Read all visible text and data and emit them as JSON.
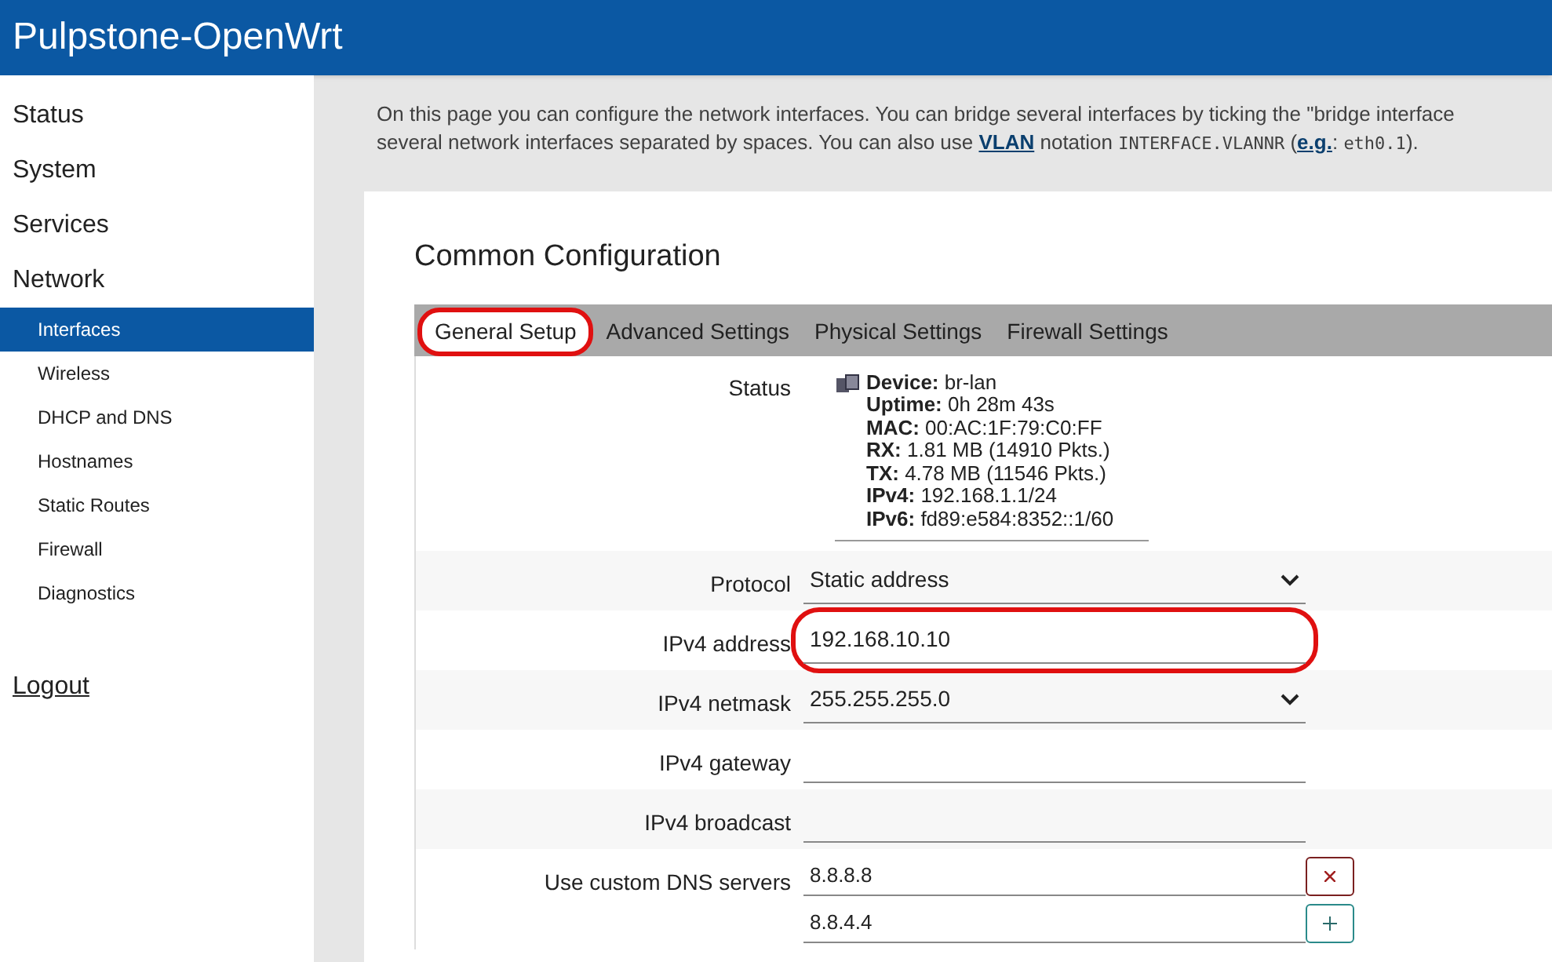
{
  "header": {
    "title": "Pulpstone-OpenWrt"
  },
  "sidebar": {
    "items": [
      {
        "label": "Status",
        "selected": false
      },
      {
        "label": "System",
        "selected": false
      },
      {
        "label": "Services",
        "selected": false
      },
      {
        "label": "Network",
        "selected": false,
        "children": [
          {
            "label": "Interfaces",
            "selected": true
          },
          {
            "label": "Wireless",
            "selected": false
          },
          {
            "label": "DHCP and DNS",
            "selected": false
          },
          {
            "label": "Hostnames",
            "selected": false
          },
          {
            "label": "Static Routes",
            "selected": false
          },
          {
            "label": "Firewall",
            "selected": false
          },
          {
            "label": "Diagnostics",
            "selected": false
          }
        ]
      }
    ],
    "logout": "Logout"
  },
  "description": {
    "line_1": "On this page you can configure the network interfaces. You can bridge several interfaces by ticking the \"bridge interface",
    "line_2": [
      {
        "kind": "text",
        "text": "several network interfaces separated by spaces. You can also use "
      },
      {
        "kind": "link",
        "text": "VLAN"
      },
      {
        "kind": "text",
        "text": " notation "
      },
      {
        "kind": "code",
        "text": "INTERFACE.VLANNR"
      },
      {
        "kind": "text",
        "text": " ("
      },
      {
        "kind": "link",
        "text": "e.g."
      },
      {
        "kind": "text",
        "text": ": "
      },
      {
        "kind": "code",
        "text": "eth0.1"
      },
      {
        "kind": "text",
        "text": ")."
      }
    ]
  },
  "section": {
    "title": "Common Configuration",
    "tabs": [
      {
        "label": "General Setup",
        "selected": true,
        "highlighted": true
      },
      {
        "label": "Advanced Settings",
        "selected": false,
        "highlighted": false
      },
      {
        "label": "Physical Settings",
        "selected": false,
        "highlighted": false
      },
      {
        "label": "Firewall Settings",
        "selected": false,
        "highlighted": false
      }
    ],
    "status": {
      "label": "Status",
      "lines": [
        "**Device:** br-lan",
        "**Uptime:** 0h 28m 43s",
        "**MAC:** 00:AC:1F:79:C0:FF",
        "**RX:** 1.81 MB (14910 Pkts.)",
        "**TX:** 4.78 MB (11546 Pkts.)",
        "**IPv4:** 192.168.1.1/24",
        "**IPv6:** fd89:e584:8352::1/60"
      ]
    },
    "fields": [
      {
        "kind": "select",
        "label": "Protocol",
        "value": "Static address"
      },
      {
        "kind": "text",
        "label": "IPv4 address",
        "value": "192.168.10.10",
        "highlighted": true
      },
      {
        "kind": "select",
        "label": "IPv4 netmask",
        "value": "255.255.255.0"
      },
      {
        "kind": "text",
        "label": "IPv4 gateway",
        "highlighted": false
      },
      {
        "kind": "text",
        "label": "IPv4 broadcast",
        "highlighted": false
      },
      {
        "kind": "list",
        "label": "Use custom DNS servers",
        "values": [
          "8.8.8.8",
          "8.8.4.4"
        ]
      }
    ]
  }
}
